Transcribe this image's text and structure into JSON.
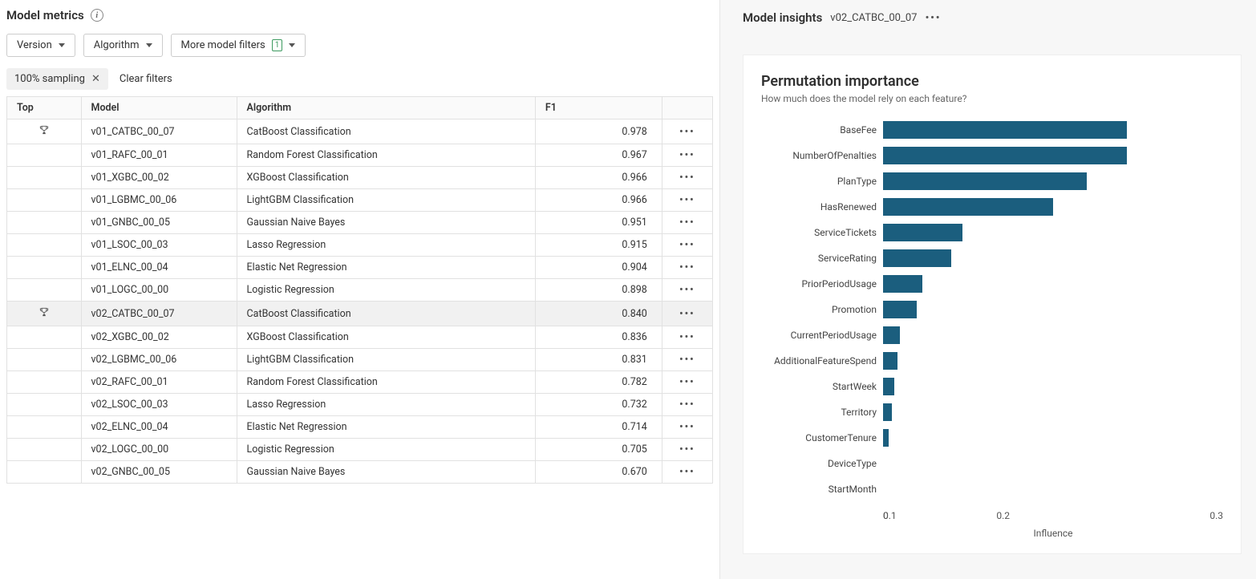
{
  "left": {
    "title": "Model metrics",
    "toolbar": {
      "version_label": "Version",
      "algorithm_label": "Algorithm",
      "more_filters_label": "More model filters",
      "more_filters_count": "1"
    },
    "chip": {
      "sampling_label": "100% sampling",
      "clear_label": "Clear filters"
    },
    "columns": {
      "top": "Top",
      "model": "Model",
      "algorithm": "Algorithm",
      "f1": "F1"
    },
    "rows": [
      {
        "top": true,
        "model": "v01_CATBC_00_07",
        "algorithm": "CatBoost Classification",
        "f1": "0.978",
        "selected": false
      },
      {
        "top": false,
        "model": "v01_RAFC_00_01",
        "algorithm": "Random Forest Classification",
        "f1": "0.967",
        "selected": false
      },
      {
        "top": false,
        "model": "v01_XGBC_00_02",
        "algorithm": "XGBoost Classification",
        "f1": "0.966",
        "selected": false
      },
      {
        "top": false,
        "model": "v01_LGBMC_00_06",
        "algorithm": "LightGBM Classification",
        "f1": "0.966",
        "selected": false
      },
      {
        "top": false,
        "model": "v01_GNBC_00_05",
        "algorithm": "Gaussian Naive Bayes",
        "f1": "0.951",
        "selected": false
      },
      {
        "top": false,
        "model": "v01_LSOC_00_03",
        "algorithm": "Lasso Regression",
        "f1": "0.915",
        "selected": false
      },
      {
        "top": false,
        "model": "v01_ELNC_00_04",
        "algorithm": "Elastic Net Regression",
        "f1": "0.904",
        "selected": false
      },
      {
        "top": false,
        "model": "v01_LOGC_00_00",
        "algorithm": "Logistic Regression",
        "f1": "0.898",
        "selected": false
      },
      {
        "top": true,
        "model": "v02_CATBC_00_07",
        "algorithm": "CatBoost Classification",
        "f1": "0.840",
        "selected": true
      },
      {
        "top": false,
        "model": "v02_XGBC_00_02",
        "algorithm": "XGBoost Classification",
        "f1": "0.836",
        "selected": false
      },
      {
        "top": false,
        "model": "v02_LGBMC_00_06",
        "algorithm": "LightGBM Classification",
        "f1": "0.831",
        "selected": false
      },
      {
        "top": false,
        "model": "v02_RAFC_00_01",
        "algorithm": "Random Forest Classification",
        "f1": "0.782",
        "selected": false
      },
      {
        "top": false,
        "model": "v02_LSOC_00_03",
        "algorithm": "Lasso Regression",
        "f1": "0.732",
        "selected": false
      },
      {
        "top": false,
        "model": "v02_ELNC_00_04",
        "algorithm": "Elastic Net Regression",
        "f1": "0.714",
        "selected": false
      },
      {
        "top": false,
        "model": "v02_LOGC_00_00",
        "algorithm": "Logistic Regression",
        "f1": "0.705",
        "selected": false
      },
      {
        "top": false,
        "model": "v02_GNBC_00_05",
        "algorithm": "Gaussian Naive Bayes",
        "f1": "0.670",
        "selected": false
      }
    ]
  },
  "right": {
    "title": "Model insights",
    "selected_model": "v02_CATBC_00_07",
    "perm_title": "Permutation importance",
    "perm_sub": "How much does the model rely on each feature?",
    "xlabel": "Influence"
  },
  "chart_data": {
    "type": "bar",
    "title": "Permutation importance",
    "xlabel": "Influence",
    "ylabel": "",
    "xlim": [
      0,
      0.3
    ],
    "ticks": [
      0,
      0.1,
      0.2,
      0.3
    ],
    "categories": [
      "BaseFee",
      "NumberOfPenalties",
      "PlanType",
      "HasRenewed",
      "ServiceTickets",
      "ServiceRating",
      "PriorPeriodUsage",
      "Promotion",
      "CurrentPeriodUsage",
      "AdditionalFeatureSpend",
      "StartWeek",
      "Territory",
      "CustomerTenure",
      "DeviceType",
      "StartMonth"
    ],
    "values": [
      0.215,
      0.215,
      0.18,
      0.15,
      0.07,
      0.06,
      0.035,
      0.03,
      0.015,
      0.013,
      0.01,
      0.008,
      0.005,
      0.0,
      0.0
    ]
  }
}
